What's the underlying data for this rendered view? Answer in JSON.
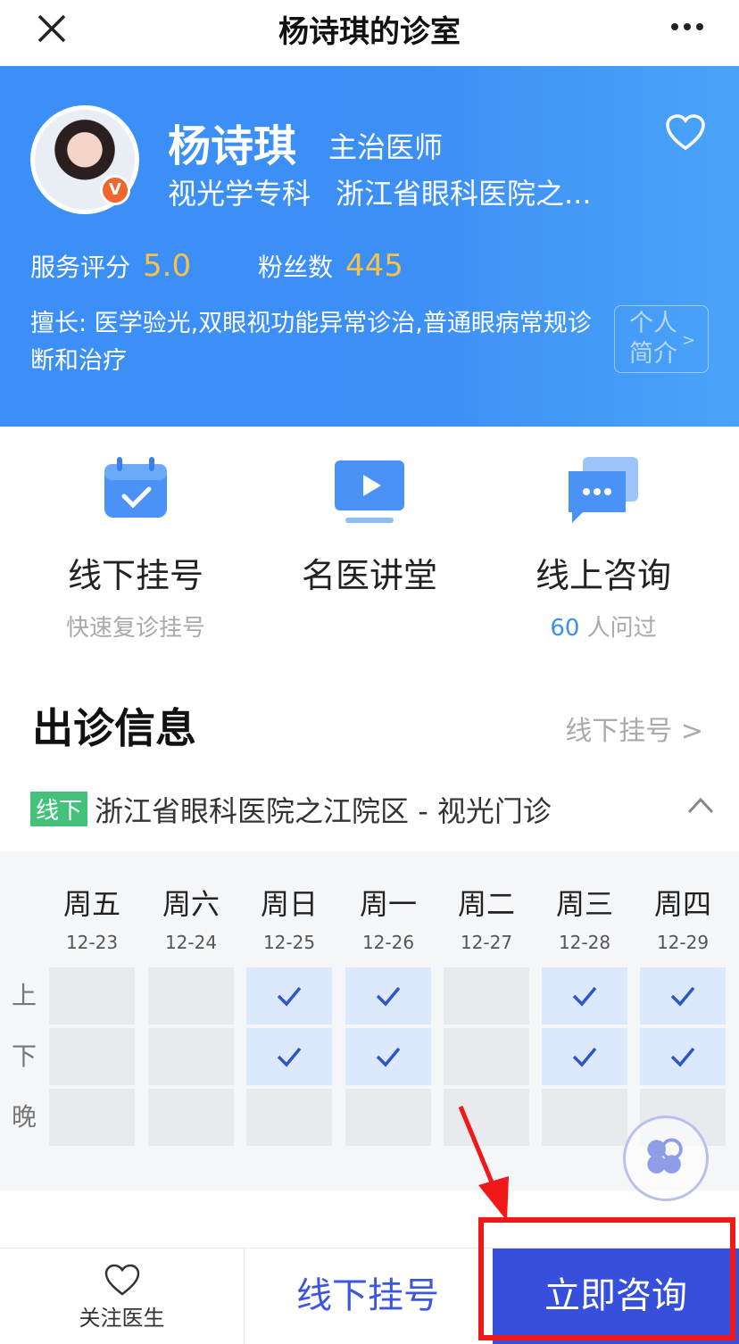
{
  "topbar": {
    "title": "杨诗琪的诊室"
  },
  "doctor": {
    "name": "杨诗琪",
    "title": "主治医师",
    "department": "视光学专科",
    "hospital": "浙江省眼科医院之...",
    "badge": "V",
    "rating_label": "服务评分",
    "rating_value": "5.0",
    "fans_label": "粉丝数",
    "fans_value": "445",
    "speciality": "擅长: 医学验光,双眼视功能异常诊治,普通眼病常规诊断和治疗",
    "bio_line1": "个人",
    "bio_line2": "简介"
  },
  "shortcuts": [
    {
      "label": "线下挂号",
      "sub": "快速复诊挂号",
      "icon": "calendar-check-icon"
    },
    {
      "label": "名医讲堂",
      "sub": "",
      "icon": "video-play-icon"
    },
    {
      "label": "线上咨询",
      "sub_num": "60",
      "sub_text": " 人问过",
      "icon": "chat-bubble-icon"
    }
  ],
  "schedule": {
    "title": "出诊信息",
    "link": "线下挂号",
    "location_tag": "线下",
    "location": "浙江省眼科医院之江院区 - 视光门诊",
    "days": [
      {
        "week": "周五",
        "date": "12-23"
      },
      {
        "week": "周六",
        "date": "12-24"
      },
      {
        "week": "周日",
        "date": "12-25"
      },
      {
        "week": "周一",
        "date": "12-26"
      },
      {
        "week": "周二",
        "date": "12-27"
      },
      {
        "week": "周三",
        "date": "12-28"
      },
      {
        "week": "周四",
        "date": "12-29"
      }
    ],
    "rows": [
      "上",
      "下",
      "晚"
    ],
    "availability": [
      [
        false,
        false,
        true,
        true,
        false,
        true,
        true
      ],
      [
        false,
        false,
        true,
        true,
        false,
        true,
        true
      ],
      [
        false,
        false,
        false,
        false,
        false,
        false,
        false
      ]
    ]
  },
  "bottom": {
    "follow": "关注医生",
    "book": "线下挂号",
    "consult": "立即咨询"
  },
  "colors": {
    "primary": "#3b8ff7",
    "accent": "#f7c24a",
    "consult": "#3750dc",
    "highlight": "#f01818"
  }
}
